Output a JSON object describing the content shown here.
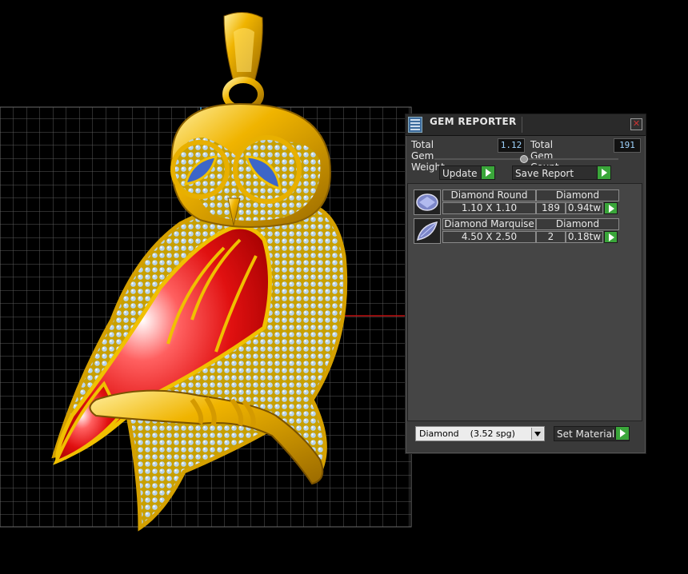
{
  "window": {
    "title": "GEM REPORTER",
    "close_glyph": "✕"
  },
  "stats": {
    "total_weight_label": "Total Gem Weight",
    "total_weight_value": "1.12",
    "total_count_label": "Total Gem Count",
    "total_count_value": "191"
  },
  "actions": {
    "update_label": "Update",
    "save_report_label": "Save Report"
  },
  "gems": [
    {
      "name": "Diamond Round",
      "material": "Diamond",
      "size": "1.10 X 1.10",
      "count": "189",
      "weight": "0.94tw",
      "icon": "round-gem-icon"
    },
    {
      "name": "Diamond Marquise",
      "material": "Diamond",
      "size": "4.50 X 2.50",
      "count": "2",
      "weight": "0.18tw",
      "icon": "marquise-gem-icon"
    }
  ],
  "material": {
    "selected": "Diamond    (3.52 spg)",
    "set_label": "Set Material"
  },
  "colors": {
    "accent_green": "#3aa63a",
    "gold": "#e8a800",
    "enamel_red": "#e01010",
    "grid": "#555555"
  }
}
